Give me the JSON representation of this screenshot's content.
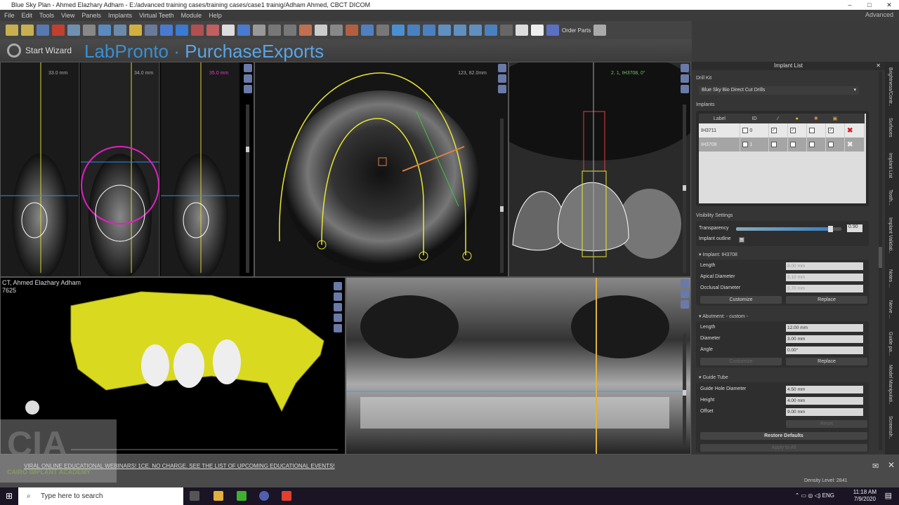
{
  "window": {
    "title": "Blue Sky Plan - Ahmed Elazhary Adham - E:/advanced training cases/training cases/case1 trainig/Adham Ahmed, CBCT DICOM",
    "minimize": "–",
    "maximize": "□",
    "close": "✕"
  },
  "menu": [
    "File",
    "Edit",
    "Tools",
    "View",
    "Panels",
    "Implants",
    "Virtual Teeth",
    "Module",
    "Help"
  ],
  "advanced": "Advanced",
  "toolbar": {
    "order_parts": "Order Parts"
  },
  "wizard": {
    "label": "Start Wizard"
  },
  "brand": {
    "lab": "LabPronto",
    "sep": "·",
    "purchase": "PurchaseExports"
  },
  "viewports": {
    "cross_labels": [
      "33.0 mm",
      "34.0 mm",
      "35.0 mm"
    ],
    "axial_label": "123, 82.0mm",
    "sagittal_label": "2. 1, IH3708, 0°",
    "threed_title": "CT, Ahmed Elazhary Adham",
    "threed_id": "7625"
  },
  "panel": {
    "title": "Implant List",
    "drill_kit_label": "Drill Kit",
    "drill_kit_value": "Blue Sky Bio Direct Cut Drills",
    "implants_label": "Implants",
    "columns": [
      "Label",
      "ID"
    ],
    "implants": [
      {
        "label": "IH3711",
        "id": "0",
        "c1": true,
        "c2": true,
        "c3": false,
        "c4": true
      },
      {
        "label": "IH3708",
        "id": "1",
        "c1": true,
        "c2": true,
        "c3": false,
        "c4": false
      }
    ],
    "visibility_label": "Visibility Settings",
    "transparency_label": "Transparency",
    "transparency_value": "0.90",
    "transparency": 0.9,
    "outline_label": "Implant outline",
    "implant_section": "Implant: IH3708",
    "implant_fields": [
      {
        "label": "Length",
        "value": "8.00 mm"
      },
      {
        "label": "Apical Diameter",
        "value": "3.10 mm"
      },
      {
        "label": "Occlusal Diameter",
        "value": "3.70 mm"
      }
    ],
    "customize": "Customize",
    "replace": "Replace",
    "abutment_section": "Abutment: - custom -",
    "abutment_fields": [
      {
        "label": "Length",
        "value": "12.00 mm"
      },
      {
        "label": "Diameter",
        "value": "3.00 mm"
      },
      {
        "label": "Angle",
        "value": "0.00°"
      }
    ],
    "guide_section": "Guide Tube",
    "guide_fields": [
      {
        "label": "Guide Hole Diameter",
        "value": "4.50 mm"
      },
      {
        "label": "Height",
        "value": "4.00 mm"
      },
      {
        "label": "Offset",
        "value": "9.00 mm"
      }
    ],
    "reset": "Reset",
    "restore": "Restore Defaults",
    "apply_all": "Apply to All"
  },
  "side_tabs": [
    "Brightness/Contr..",
    "Surfaces",
    "Implant List",
    "Tooth...",
    "Implant Validati..",
    "Notes ...",
    "Nerve ...",
    "Guide pa...",
    "Model Manipulati..",
    "Screensh.."
  ],
  "status": {
    "news": "VIRAL ONLINE EDUCATIONAL WEBINARS! 1CE. NO CHARGE. SEE THE LIST OF UPCOMING EDUCATIONAL EVENTS!",
    "density": "Density Level: 2841"
  },
  "watermark": {
    "big": "CIA",
    "small": "CAIRO IMPLANT ACADEMY"
  },
  "taskbar": {
    "search_placeholder": "Type here to search",
    "lang": "ENG",
    "time": "11:18 AM",
    "date": "7/9/2020"
  }
}
